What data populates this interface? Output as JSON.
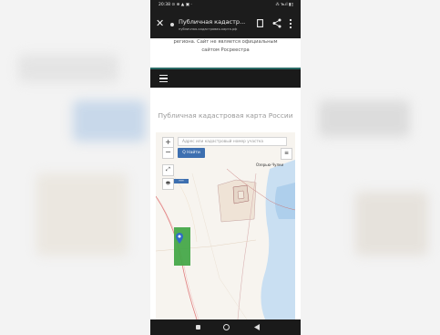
{
  "status_bar": {
    "time": "20:38",
    "left_icons": "⊙ ⊕ ▲ ▣ ·",
    "right_status": "⁂ ℡ıl ▮▯"
  },
  "browser": {
    "tab_title": "Публичная кадастр...",
    "url": "публичная-кадастровая-карта.рф"
  },
  "notice": {
    "line1": "региона. Сайт не является официальным",
    "line2": "сайтом Росреестра"
  },
  "page_title": "Публичная кадастровая карта России",
  "map": {
    "zoom_in_label": "+",
    "zoom_out_label": "−",
    "fullscreen_label": "⤢",
    "print_label": "🖶",
    "search_placeholder": "Адрес или кадастровый номер участка",
    "find_button_label": "Q Найти",
    "layers_label": "≡",
    "place_label": "Озерью-Чулки",
    "scale_label": "━━━"
  },
  "colors": {
    "accent_blue": "#3d6fb0",
    "field_green": "#46a849",
    "nav_dark": "#1a1a1a",
    "teal_line": "#2a6b66",
    "water": "#c9dff2"
  },
  "icons": {
    "close": "close-icon",
    "bookmark": "bookmark-icon",
    "share": "share-icon",
    "more": "more-icon",
    "hamburger": "hamburger-icon",
    "marker": "map-marker-icon"
  }
}
